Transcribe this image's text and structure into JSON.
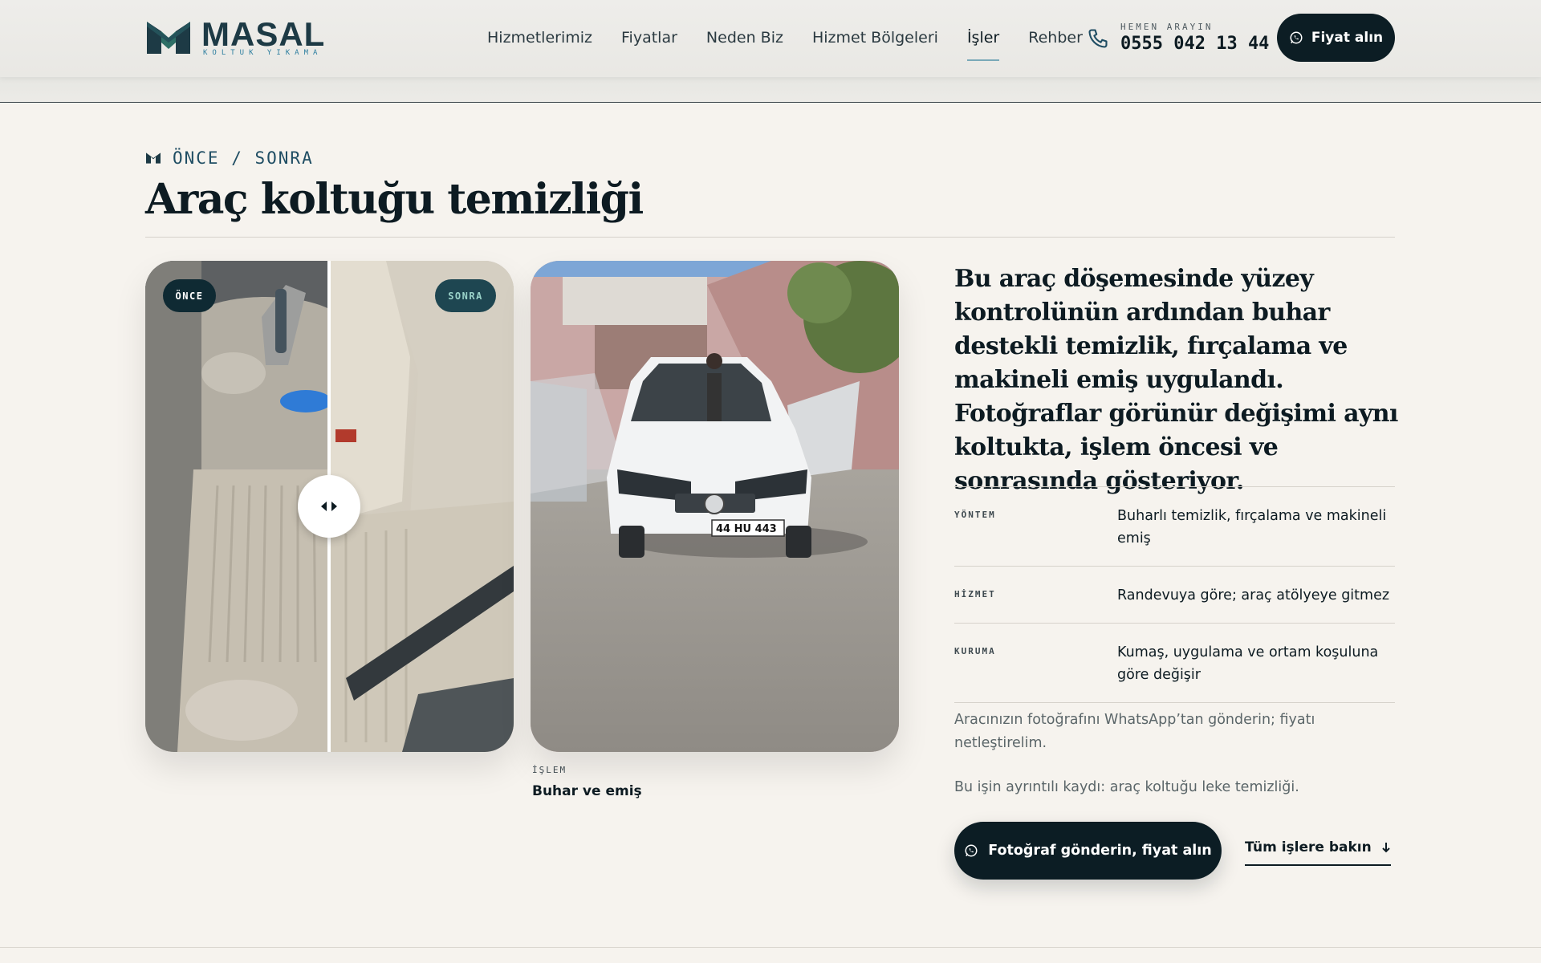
{
  "header": {
    "logo_word": "MASAL",
    "logo_tagline": "KOLTUK YIKAMA",
    "nav": [
      {
        "label": "Hizmetlerimiz"
      },
      {
        "label": "Fiyatlar"
      },
      {
        "label": "Neden Biz"
      },
      {
        "label": "Hizmet Bölgeleri"
      },
      {
        "label": "İşler",
        "active": true
      },
      {
        "label": "Rehber"
      }
    ],
    "phone_label": "HEMEN ARAYIN",
    "phone_number": "0555 042 13 44",
    "cta_label": "Fiyat alın"
  },
  "main": {
    "eyebrow": "ÖNCE / SONRA",
    "title": "Araç koltuğu temizliği",
    "before_label": "ÖNCE",
    "after_label": "SONRA",
    "caption_label": "İŞLEM",
    "caption_value": "Buhar ve emiş",
    "car_plate": "44 HU 443",
    "lead": "Bu araç döşemesinde yüzey kontrolünün ardından buhar destekli temizlik, fırçalama ve makineli emiş uygulandı. Fotoğraflar görünür değişimi aynı koltukta, işlem öncesi ve sonrasında gösteriyor.",
    "specs": [
      {
        "key": "YÖNTEM",
        "value": "Buharlı temizlik, fırçalama ve makineli emiş"
      },
      {
        "key": "HİZMET",
        "value": "Randevuya göre; araç atölyeye gitmez"
      },
      {
        "key": "KURUMA",
        "value": "Kumaş, uygulama ve ortam koşuluna göre değişir"
      }
    ],
    "note_whatsapp": "Aracınızın fotoğrafını WhatsApp’tan gönderin; fiyatı netleştirelim.",
    "note_record": "Bu işin ayrıntılı kaydı: araç koltuğu leke temizliği.",
    "cta_main_label": "Fotoğraf gönderin, fiyat alın",
    "link_all_label": "Tüm işlere bakın"
  },
  "colors": {
    "page_bg": "#f6f3ee",
    "ink": "#0d1b22",
    "brand_dark": "#0c1d24",
    "brand_teal": "#2e7fa0"
  }
}
